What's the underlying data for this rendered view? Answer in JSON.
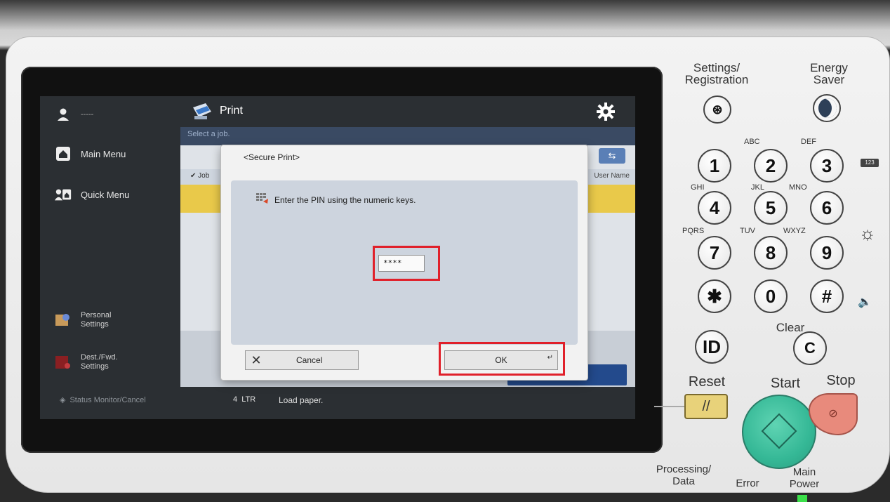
{
  "sidebar": {
    "user_dashes": "-----",
    "items": [
      {
        "label": "Main Menu"
      },
      {
        "label": "Quick Menu"
      },
      {
        "label": "Personal\nSettings"
      },
      {
        "label": "Dest./Fwd.\nSettings"
      }
    ],
    "status_monitor": "Status Monitor/Cancel"
  },
  "topbar": {
    "title": "Print"
  },
  "main": {
    "select_prompt": "Select a job.",
    "job_column": "Job",
    "user_name_column": "User Name"
  },
  "statusbar": {
    "count": "4  LTR",
    "message": "Load paper."
  },
  "dialog": {
    "title": "<Secure Print>",
    "message": "Enter the PIN using the numeric keys.",
    "pin_value": "****",
    "cancel_label": "Cancel",
    "ok_label": "OK"
  },
  "keypad": {
    "settings_label": "Settings/\nRegistration",
    "energy_label": "Energy\nSaver",
    "keys": [
      {
        "digit": "1",
        "letters": ""
      },
      {
        "digit": "2",
        "letters": "ABC"
      },
      {
        "digit": "3",
        "letters": "DEF"
      },
      {
        "digit": "4",
        "letters": "GHI"
      },
      {
        "digit": "5",
        "letters": "JKL"
      },
      {
        "digit": "6",
        "letters": "MNO"
      },
      {
        "digit": "7",
        "letters": "PQRS"
      },
      {
        "digit": "8",
        "letters": "TUV"
      },
      {
        "digit": "9",
        "letters": "WXYZ"
      },
      {
        "digit": "✱",
        "letters": ""
      },
      {
        "digit": "0",
        "letters": ""
      },
      {
        "digit": "#",
        "letters": ""
      }
    ],
    "id_key": "ID",
    "clear_label": "Clear",
    "clear_key": "C",
    "reset_label": "Reset",
    "start_label": "Start",
    "stop_label": "Stop",
    "badge_123": "123",
    "processing_label": "Processing/\nData",
    "error_label": "Error",
    "main_power_label": "Main\nPower"
  },
  "colors": {
    "highlight": "#e0202a",
    "start_green": "#35b896",
    "stop_red": "#e88a7c",
    "reset_yellow": "#e8d27a"
  }
}
